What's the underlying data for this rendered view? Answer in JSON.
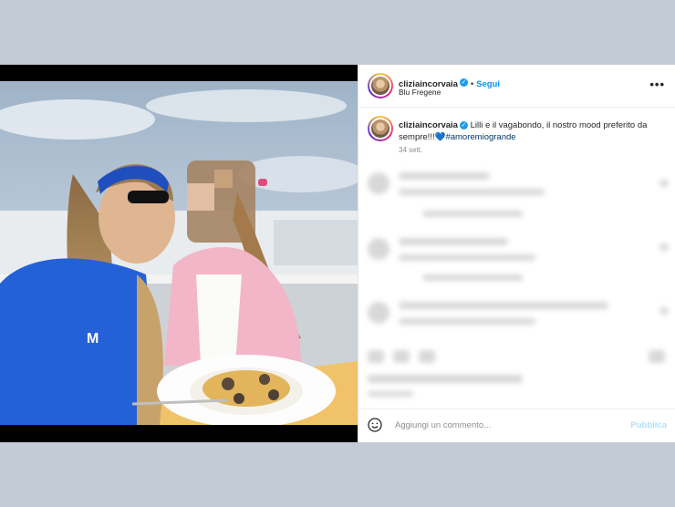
{
  "header": {
    "username": "cliziaincorvaia",
    "follow_label": "Segui",
    "location": "Blu Fregene",
    "more_label": "•••"
  },
  "caption": {
    "username": "cliziaincorvaia",
    "text": "Lilli e il vagabondo, il nostro mood preferito da sempre!!!",
    "emoji": "💙",
    "hashtag": "#amoremiogrande",
    "age": "34 sett."
  },
  "footer": {
    "placeholder": "Aggiungi un commento...",
    "publish_label": "Pubblica"
  },
  "colors": {
    "accent": "#0095f6",
    "publish_disabled": "#b2dffc",
    "background": "#c3cbd6"
  },
  "icons": [
    "verified-badge-icon",
    "more-options-icon",
    "emoji-icon"
  ]
}
